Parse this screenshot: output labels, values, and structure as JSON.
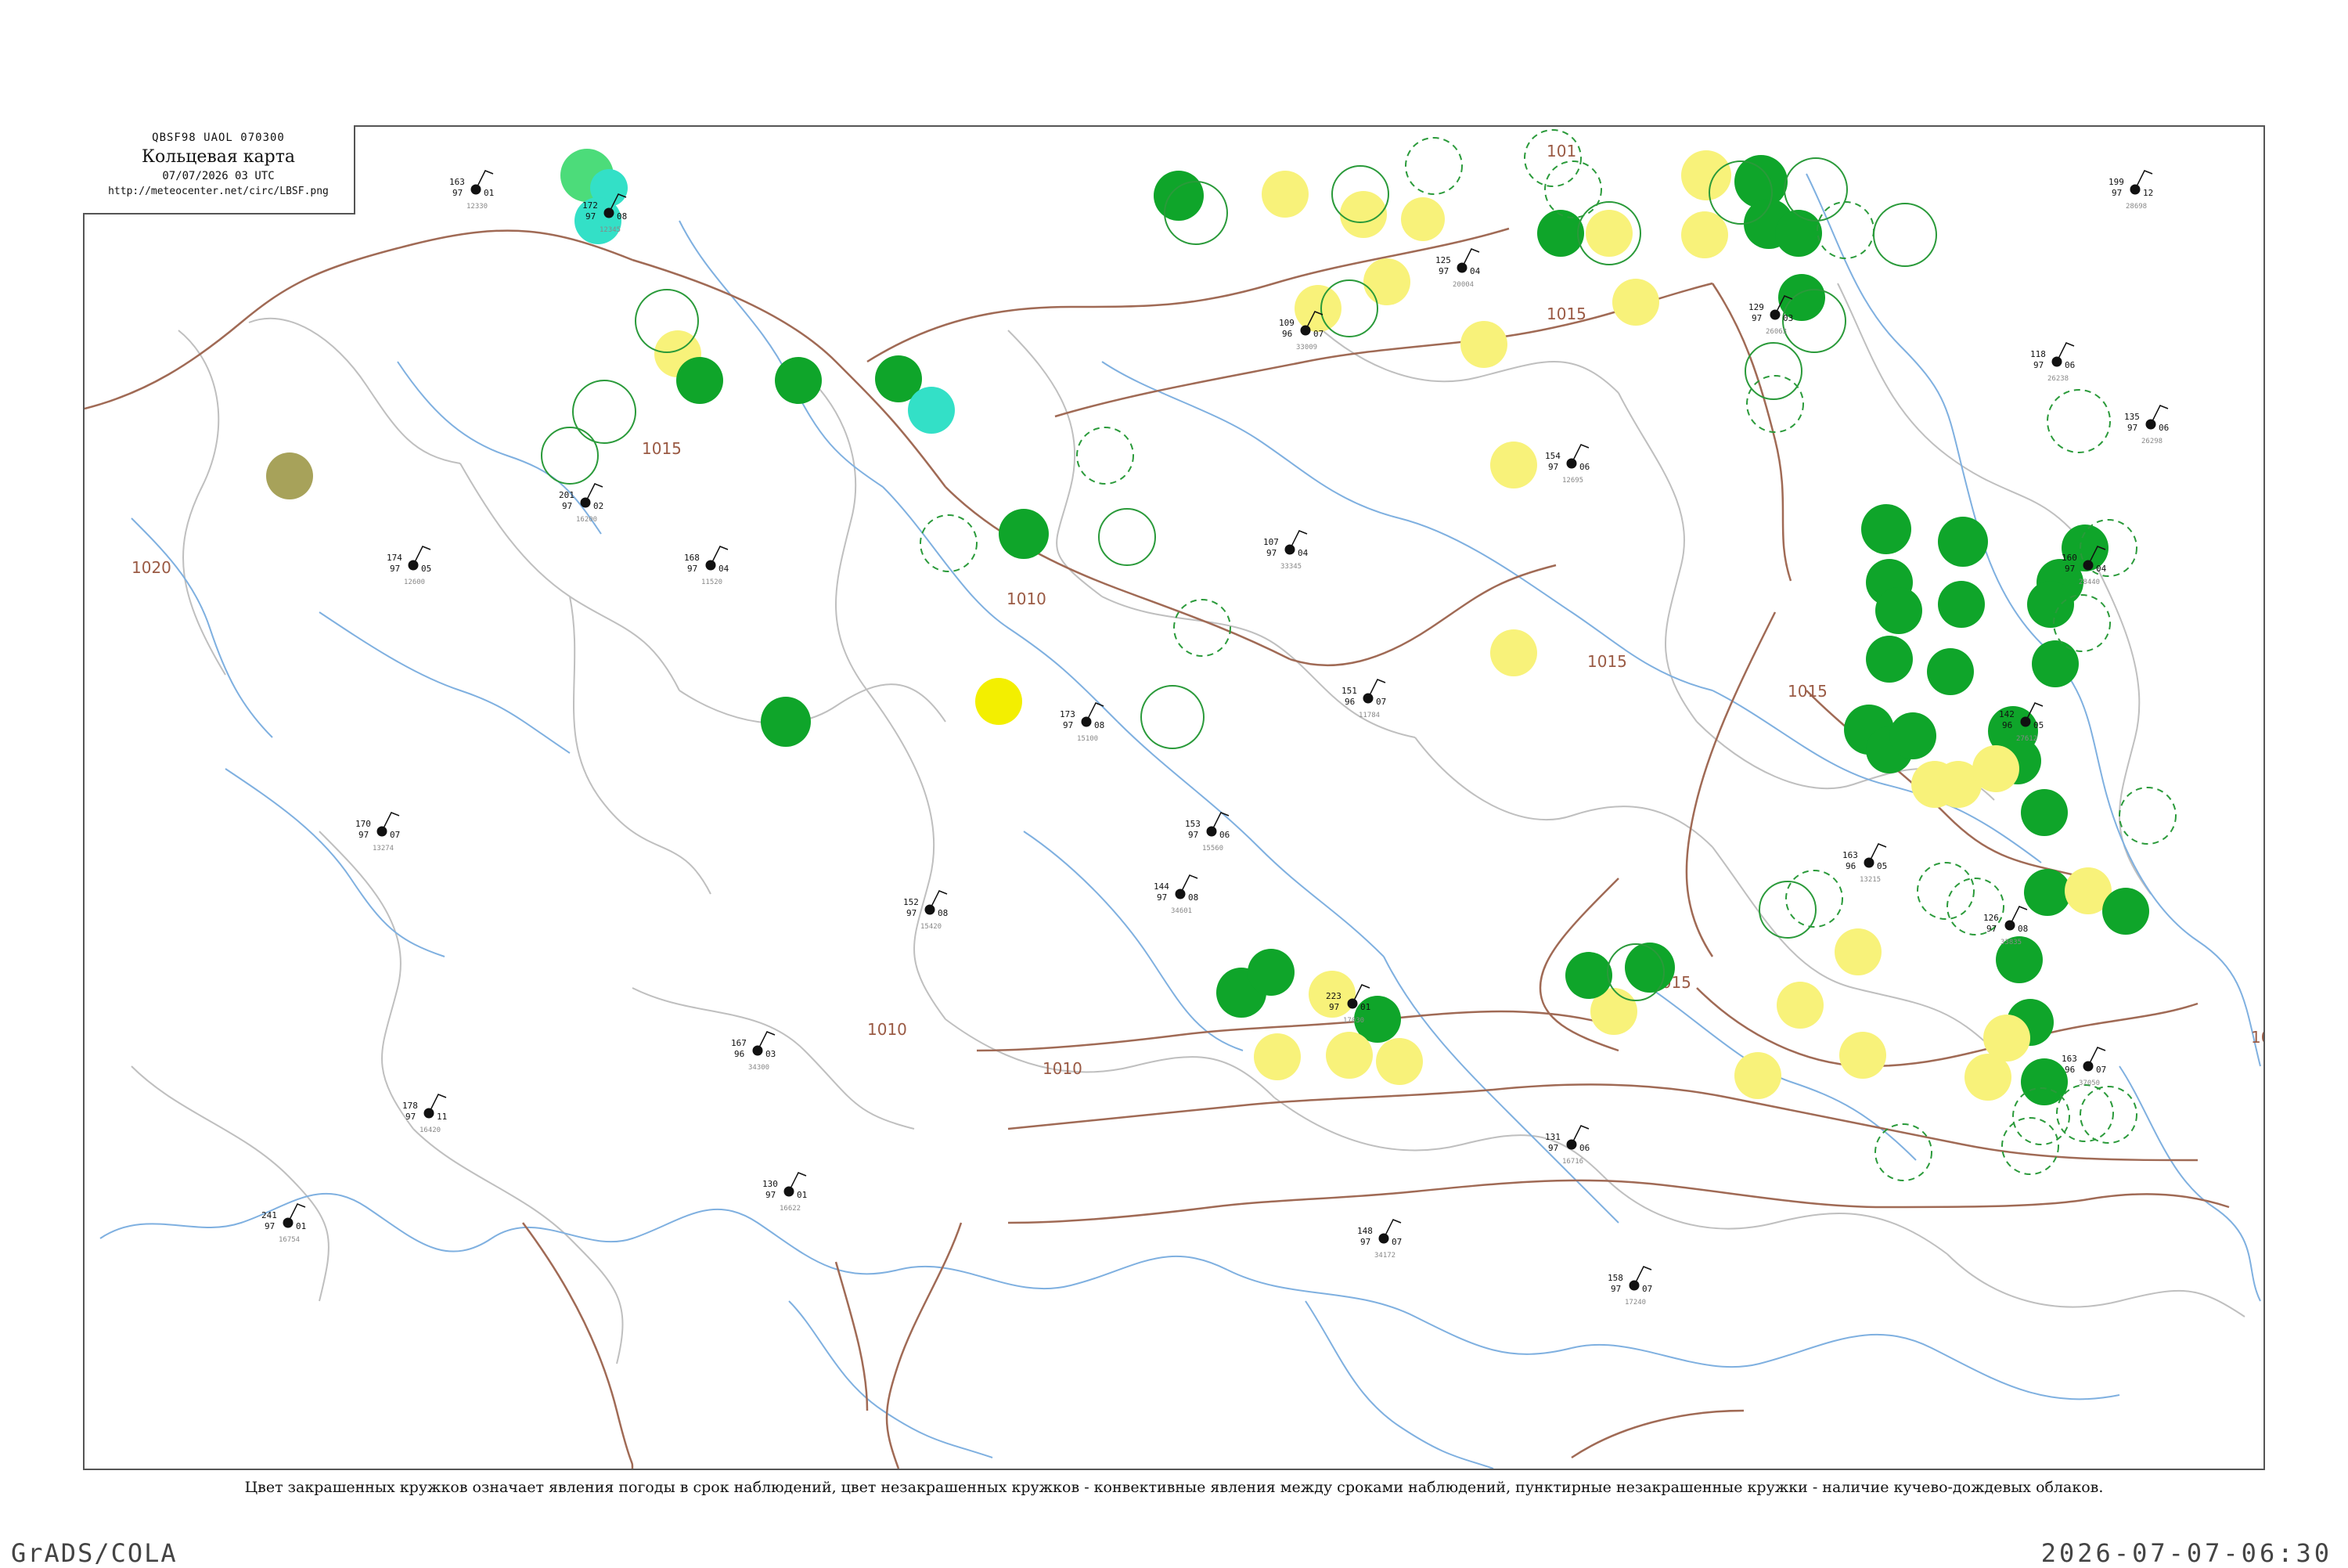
{
  "header": {
    "code_line": "QBSF98  UAOL  070300",
    "title": "Кольцевая карта",
    "date": "07/07/2026 03 UTC",
    "url": "http://meteocenter.net/circ/LBSF.png"
  },
  "caption": "Цвет закрашенных кружков означает явления погоды в срок наблюдений, цвет незакрашенных кружков - конвективные явления между сроками наблюдений, пунктирные незакрашенные кружки - наличие кучево-дождевых облаков.",
  "footer": {
    "software": "GrADS/COLA",
    "timestamp": "2026-07-07-06:30"
  },
  "colors": {
    "isobar": "#a06a55",
    "river": "#7fb0e0",
    "border": "#bfbfbf",
    "rain": "#0fa52a",
    "rain_light": "#4cdc7a",
    "shower": "#33e0c7",
    "haze": "#f8f27a",
    "fog": "#f3ef00",
    "dust": "#a7a25a",
    "cb_ring": "#2a9a3a"
  },
  "isobar_labels": [
    {
      "text": "1020"
    },
    {
      "text": "1015"
    },
    {
      "text": "1015"
    },
    {
      "text": "1010"
    },
    {
      "text": "1015"
    },
    {
      "text": "1015"
    },
    {
      "text": "1015"
    },
    {
      "text": "1010"
    },
    {
      "text": "1010"
    },
    {
      "text": "101"
    },
    {
      "text": "101"
    }
  ],
  "stations": [
    {
      "p": "163",
      "t": "97",
      "td": "01",
      "id": "12330"
    },
    {
      "p": "172",
      "t": "97",
      "td": "08",
      "id": "12345"
    },
    {
      "p": "151",
      "t": "96",
      "td": "07",
      "id": "11784"
    },
    {
      "p": "163",
      "t": "96",
      "td": "05",
      "id": "13215"
    },
    {
      "p": "154",
      "t": "97",
      "td": "06",
      "id": "12695"
    },
    {
      "p": "173",
      "t": "97",
      "td": "08",
      "id": "15100"
    },
    {
      "p": "125",
      "t": "97",
      "td": "04",
      "id": "20004"
    },
    {
      "p": "118",
      "t": "97",
      "td": "06",
      "id": "26238"
    },
    {
      "p": "129",
      "t": "97",
      "td": "03",
      "id": "26063"
    },
    {
      "p": "107",
      "t": "97",
      "td": "04",
      "id": "33345"
    },
    {
      "p": "144",
      "t": "97",
      "td": "08",
      "id": "34601"
    },
    {
      "p": "148",
      "t": "97",
      "td": "07",
      "id": "34172"
    },
    {
      "p": "163",
      "t": "96",
      "td": "07",
      "id": "37050"
    },
    {
      "p": "167",
      "t": "96",
      "td": "03",
      "id": "34300"
    },
    {
      "p": "223",
      "t": "97",
      "td": "01",
      "id": "17030"
    },
    {
      "p": "158",
      "t": "97",
      "td": "07",
      "id": "17240"
    },
    {
      "p": "131",
      "t": "97",
      "td": "06",
      "id": "16716"
    },
    {
      "p": "199",
      "t": "97",
      "td": "12",
      "id": "28698"
    },
    {
      "p": "160",
      "t": "97",
      "td": "04",
      "id": "28440"
    },
    {
      "p": "142",
      "t": "96",
      "td": "05",
      "id": "27612"
    },
    {
      "p": "135",
      "t": "97",
      "td": "06",
      "id": "26298"
    },
    {
      "p": "109",
      "t": "96",
      "td": "07",
      "id": "33009"
    },
    {
      "p": "174",
      "t": "97",
      "td": "05",
      "id": "12600"
    },
    {
      "p": "201",
      "t": "97",
      "td": "02",
      "id": "16200"
    },
    {
      "p": "170",
      "t": "97",
      "td": "07",
      "id": "13274"
    },
    {
      "p": "241",
      "t": "97",
      "td": "01",
      "id": "16754"
    },
    {
      "p": "178",
      "t": "97",
      "td": "11",
      "id": "16420"
    },
    {
      "p": "130",
      "t": "97",
      "td": "01",
      "id": "16622"
    },
    {
      "p": "152",
      "t": "97",
      "td": "08",
      "id": "15420"
    },
    {
      "p": "126",
      "t": "97",
      "td": "08",
      "id": "33835"
    },
    {
      "p": "153",
      "t": "97",
      "td": "06",
      "id": "15560"
    },
    {
      "p": "168",
      "t": "97",
      "td": "04",
      "id": "11520"
    }
  ]
}
